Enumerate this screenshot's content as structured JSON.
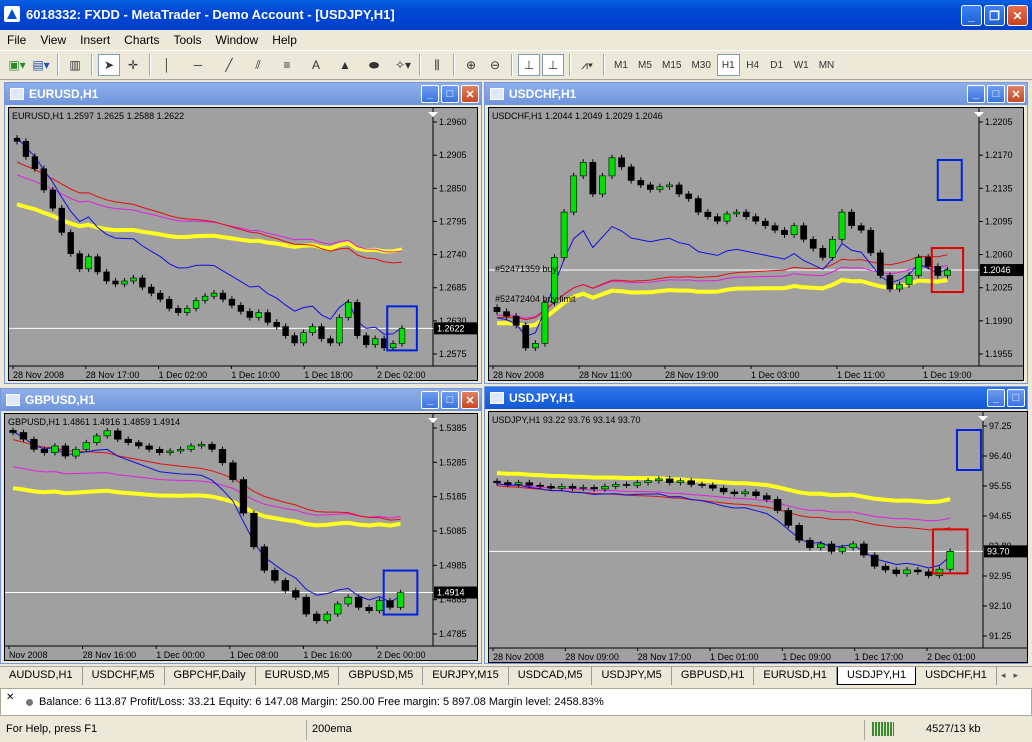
{
  "app": {
    "title": "6018332: FXDD - MetaTrader - Demo Account - [USDJPY,H1]",
    "menu": [
      "File",
      "View",
      "Insert",
      "Charts",
      "Tools",
      "Window",
      "Help"
    ],
    "timeframes": [
      "M1",
      "M5",
      "M15",
      "M30",
      "H1",
      "H4",
      "D1",
      "W1",
      "MN"
    ],
    "active_timeframe": "H1"
  },
  "charts": [
    {
      "id": "eurusd",
      "window_title": "EURUSD,H1",
      "header": "EURUSD,H1  1.2597 1.2625 1.2588 1.2622",
      "active": false,
      "price_labels": [
        "1.2960",
        "1.2905",
        "1.2850",
        "1.2795",
        "1.2740",
        "1.2685",
        "1.2630",
        "1.2575"
      ],
      "current_price": "1.2622",
      "time_labels": [
        "28 Nov 2008",
        "28 Nov 17:00",
        "1 Dec 02:00",
        "1 Dec 10:00",
        "1 Dec 18:00",
        "2 Dec 02:00"
      ],
      "order_labels": [],
      "highlight": "blue",
      "ylim": [
        1.256,
        1.2985
      ],
      "current": 1.2622,
      "closes": [
        1.293,
        1.2905,
        1.2885,
        1.285,
        1.282,
        1.278,
        1.2745,
        1.272,
        1.274,
        1.2715,
        1.27,
        1.2695,
        1.27,
        1.2705,
        1.269,
        1.268,
        1.267,
        1.2655,
        1.2648,
        1.2655,
        1.2668,
        1.2675,
        1.268,
        1.267,
        1.266,
        1.265,
        1.264,
        1.2648,
        1.2632,
        1.2625,
        1.261,
        1.2598,
        1.2615,
        1.2625,
        1.2605,
        1.2598,
        1.264,
        1.2665,
        1.261,
        1.2595,
        1.2605,
        1.259,
        1.2597,
        1.2622
      ],
      "ema_blue": {
        "color": "#1010e0",
        "from": 1.2945,
        "to": 1.2625
      },
      "ema_red": {
        "color": "#e01010",
        "from": 1.289,
        "to": 1.275
      },
      "ema_magenta": {
        "color": "#e020e0",
        "from": 1.2865,
        "to": 1.2772
      },
      "ema_yellow": {
        "color": "#ffff20",
        "from": 1.2808,
        "to": 1.2775
      }
    },
    {
      "id": "usdchf",
      "window_title": "USDCHF,H1",
      "header": "USDCHF,H1  1.2044 1.2049 1.2029 1.2046",
      "active": false,
      "price_labels": [
        "1.2205",
        "1.2170",
        "1.2135",
        "1.2095",
        "1.2060",
        "1.2025",
        "1.1990",
        "1.1955"
      ],
      "current_price": "1.2046",
      "time_labels": [
        "28 Nov 2008",
        "28 Nov 11:00",
        "28 Nov 19:00",
        "1 Dec 03:00",
        "1 Dec 11:00",
        "1 Dec 19:00"
      ],
      "order_labels": [
        "#52471359 buy",
        "#52472404 buy limit"
      ],
      "highlight": "red",
      "ylim": [
        1.194,
        1.2225
      ],
      "current": 1.2046,
      "closes": [
        1.2,
        1.1995,
        1.1985,
        1.196,
        1.1965,
        1.201,
        1.206,
        1.211,
        1.215,
        1.2165,
        1.213,
        1.215,
        1.217,
        1.216,
        1.2145,
        1.214,
        1.2135,
        1.2138,
        1.214,
        1.213,
        1.2125,
        1.211,
        1.2105,
        1.21,
        1.2108,
        1.211,
        1.2105,
        1.21,
        1.2095,
        1.209,
        1.2085,
        1.2095,
        1.208,
        1.207,
        1.206,
        1.208,
        1.211,
        1.2095,
        1.209,
        1.2065,
        1.204,
        1.2025,
        1.203,
        1.204,
        1.206,
        1.205,
        1.204,
        1.2046
      ],
      "ema_blue": {
        "color": "#1010e0",
        "from": 1.1985,
        "to": 1.2048
      },
      "ema_red": {
        "color": "#e01010",
        "from": 1.1992,
        "to": 1.2066
      },
      "ema_magenta": {
        "color": "#e020e0",
        "from": 1.1995,
        "to": 1.2052
      },
      "ema_yellow": {
        "color": "#ffff20",
        "from": 1.1985,
        "to": 1.2033
      }
    },
    {
      "id": "gbpusd",
      "window_title": "GBPUSD,H1",
      "header": "GBPUSD,H1  1.4861 1.4916 1.4859 1.4914",
      "active": false,
      "price_labels": [
        "1.5385",
        "1.5285",
        "1.5185",
        "1.5085",
        "1.4985",
        "1.4885",
        "1.4785"
      ],
      "current_price": "1.4914",
      "time_labels": [
        "Nov 2008",
        "28 Nov 16:00",
        "1 Dec 00:00",
        "1 Dec 08:00",
        "1 Dec 16:00",
        "2 Dec 00:00"
      ],
      "order_labels": [],
      "highlight": "blue",
      "ylim": [
        1.4755,
        1.5445
      ],
      "current": 1.4914,
      "closes": [
        1.539,
        1.537,
        1.534,
        1.533,
        1.535,
        1.532,
        1.534,
        1.536,
        1.538,
        1.5395,
        1.537,
        1.536,
        1.535,
        1.534,
        1.533,
        1.5335,
        1.534,
        1.535,
        1.5355,
        1.534,
        1.53,
        1.525,
        1.515,
        1.505,
        1.498,
        1.495,
        1.492,
        1.49,
        1.485,
        1.483,
        1.485,
        1.488,
        1.49,
        1.487,
        1.486,
        1.489,
        1.487,
        1.4914
      ],
      "ema_blue": {
        "color": "#1010e0",
        "from": 1.5395,
        "to": 1.489
      },
      "ema_red": {
        "color": "#e01010",
        "from": 1.5365,
        "to": 1.517
      },
      "ema_magenta": {
        "color": "#e020e0",
        "from": 1.527,
        "to": 1.518
      },
      "ema_yellow": {
        "color": "#ffff20",
        "from": 1.5195,
        "to": 1.5155
      }
    },
    {
      "id": "usdjpy",
      "window_title": "USDJPY,H1",
      "header": "USDJPY,H1  93.22 93.76 93.14 93.70",
      "active": true,
      "price_labels": [
        "97.25",
        "96.40",
        "95.55",
        "94.65",
        "93.80",
        "92.95",
        "92.10",
        "91.25"
      ],
      "current_price": "93.70",
      "time_labels": [
        "28 Nov 2008",
        "28 Nov 09:00",
        "28 Nov 17:00",
        "1 Dec 01:00",
        "1 Dec 09:00",
        "1 Dec 17:00",
        "2 Dec 01:00"
      ],
      "order_labels": [],
      "highlight": "red",
      "ylim": [
        91.1,
        97.45
      ],
      "current": 93.7,
      "closes": [
        95.55,
        95.5,
        95.55,
        95.48,
        95.45,
        95.4,
        95.45,
        95.4,
        95.42,
        95.38,
        95.45,
        95.5,
        95.48,
        95.55,
        95.6,
        95.65,
        95.55,
        95.6,
        95.5,
        95.48,
        95.4,
        95.3,
        95.25,
        95.3,
        95.2,
        95.1,
        94.8,
        94.4,
        94.0,
        93.8,
        93.9,
        93.7,
        93.8,
        93.9,
        93.6,
        93.3,
        93.2,
        93.1,
        93.2,
        93.15,
        93.05,
        93.22,
        93.7
      ],
      "ema_blue": {
        "color": "#1010e0",
        "from": 95.5,
        "to": 93.4
      },
      "ema_red": {
        "color": "#e01010",
        "from": 95.45,
        "to": 94.45
      },
      "ema_magenta": {
        "color": "#e020e0",
        "from": 95.5,
        "to": 94.75
      },
      "ema_yellow": {
        "color": "#ffff20",
        "from": 95.85,
        "to": 95.35
      }
    }
  ],
  "tabs": [
    "AUDUSD,H1",
    "USDCHF,M5",
    "GBPCHF,Daily",
    "EURUSD,M5",
    "GBPUSD,M5",
    "EURJPY,M15",
    "USDCAD,M5",
    "USDJPY,M5",
    "GBPUSD,H1",
    "EURUSD,H1",
    "USDJPY,H1",
    "USDCHF,H1"
  ],
  "active_tab": "USDJPY,H1",
  "terminal": {
    "summary": "Balance: 6 113.87  Profit/Loss: 33.21  Equity: 6 147.08  Margin: 250.00  Free margin: 5 897.08  Margin level: 2458.83%"
  },
  "status": {
    "help": "For Help, press F1",
    "profile": "200ema",
    "traffic": "4527/13 kb"
  }
}
